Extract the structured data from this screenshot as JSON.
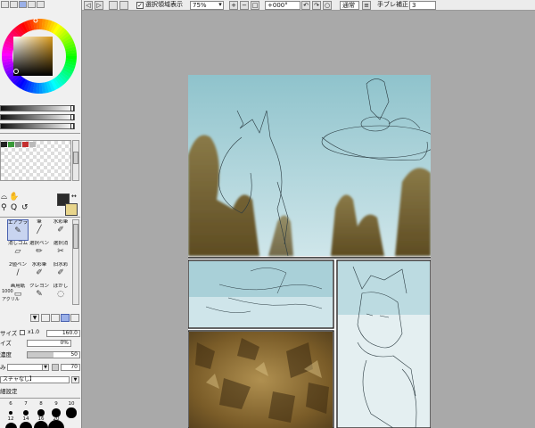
{
  "top_toolbar": {
    "show_selection_label": "選択領域表示",
    "zoom_value": "75%",
    "rotation_value": "+000°",
    "blend_mode_value": "通常",
    "stabilizer_label": "手ブレ補正",
    "stabilizer_value": "3"
  },
  "brush_panel": {
    "tools": [
      {
        "label": "エアブラシ",
        "icon": "airbrush-icon"
      },
      {
        "label": "筆",
        "icon": "brush-icon"
      },
      {
        "label": "水彩筆",
        "icon": "watercolor-icon"
      },
      {
        "label": "消しゴム",
        "icon": "eraser-icon"
      },
      {
        "label": "選択ペン",
        "icon": "selection-pen-icon"
      },
      {
        "label": "選択消",
        "icon": "selection-eraser-icon"
      },
      {
        "label": "2値ペン",
        "icon": "binary-pen-icon"
      },
      {
        "label": "水彩筆",
        "icon": "watercolor-icon"
      },
      {
        "label": "旧水彩",
        "icon": "old-watercolor-icon"
      },
      {
        "label": "画用紙",
        "icon": "drawing-paper-icon"
      },
      {
        "label": "クレヨン",
        "icon": "crayon-icon"
      },
      {
        "label": "ぼかし",
        "icon": "blur-icon"
      }
    ],
    "tool_sublabels": [
      "1000",
      "アクリル"
    ],
    "size_label": "サイズ",
    "size_multiplier": "x1.0",
    "size_value": "160.0",
    "min_size_label": "イズ",
    "min_size_value": "0%",
    "density_label": "濃度",
    "density_value": "50",
    "shape_label": "み",
    "shape_value": "70",
    "texture_label": "スチャなし】",
    "advanced_label": "細設定",
    "dot_sizes": [
      "6",
      "7",
      "8",
      "9",
      "10",
      "12",
      "14",
      "16",
      "20"
    ]
  },
  "colors": {
    "foreground": "#2b2b2b",
    "background": "#e8d58c",
    "canvas_sky": "#a8cfd6",
    "canvas_rock": "#7a6535"
  }
}
